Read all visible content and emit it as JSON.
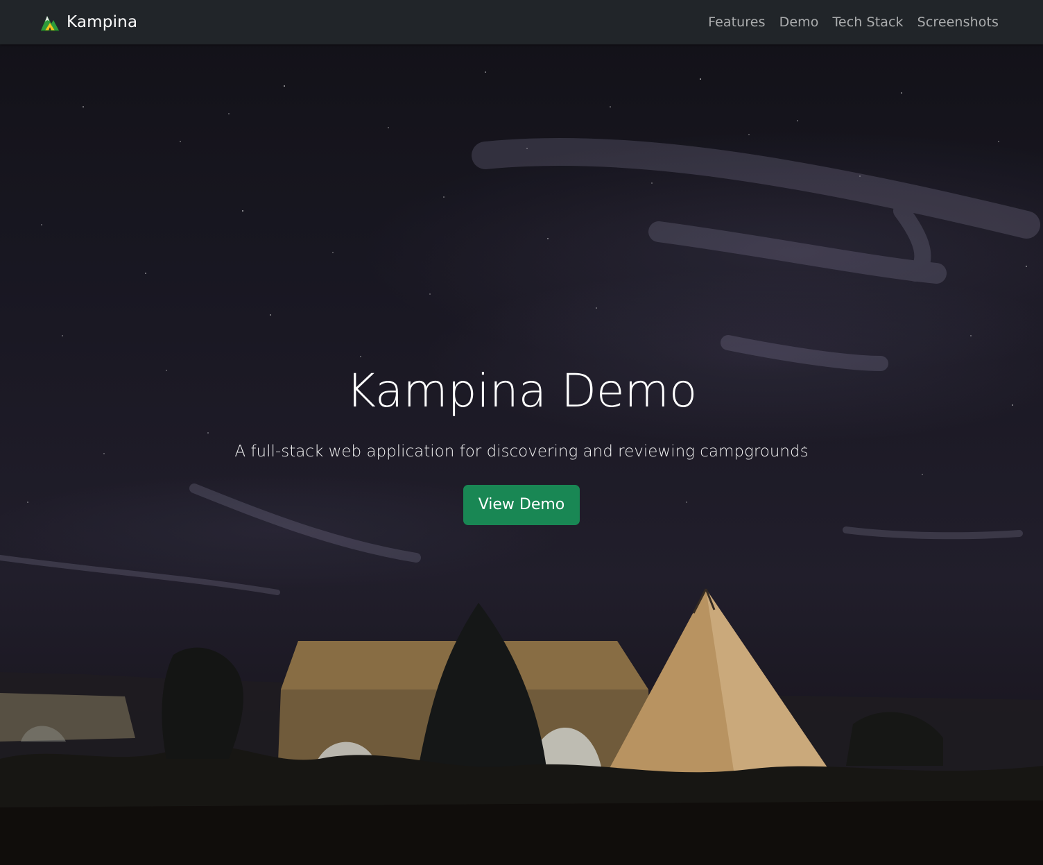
{
  "navbar": {
    "brand": "Kampina",
    "brand_icon": "mountain-tent-logo-icon",
    "links": [
      {
        "label": "Features"
      },
      {
        "label": "Demo"
      },
      {
        "label": "Tech Stack"
      },
      {
        "label": "Screenshots"
      }
    ]
  },
  "hero": {
    "title": "Kampina Demo",
    "subtitle": "A full-stack web application for discovering and reviewing campgrounds",
    "cta_label": "View Demo",
    "background": "night-sky-campground-tents-image"
  },
  "colors": {
    "navbar_bg": "#212529",
    "button_bg": "#198754",
    "link_color": "rgba(255,255,255,0.62)"
  }
}
